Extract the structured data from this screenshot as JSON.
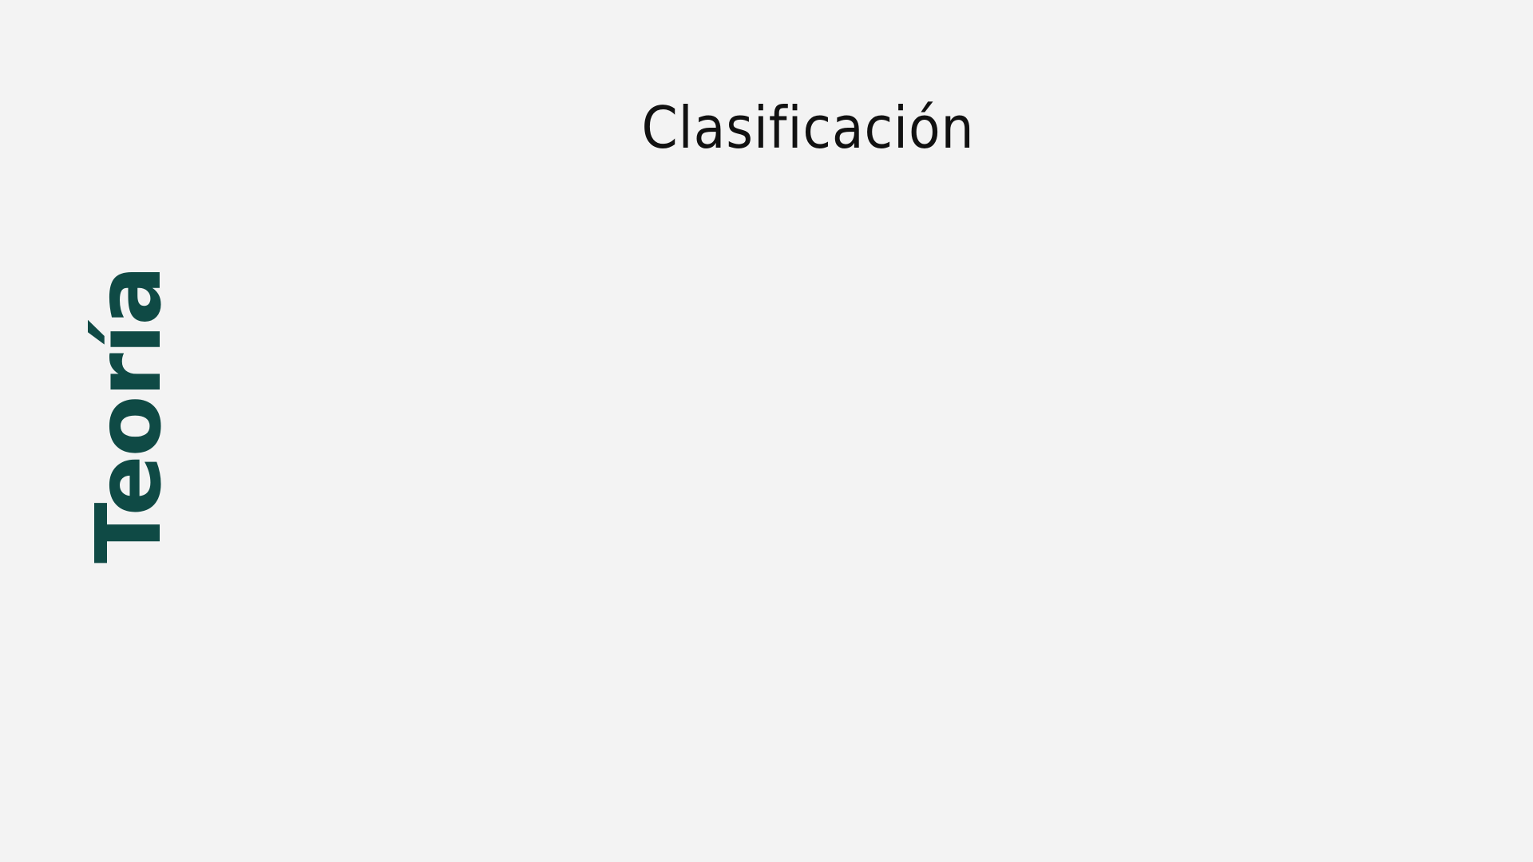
{
  "slide": {
    "title": "Clasificación",
    "section_label": "Teoría"
  },
  "colors": {
    "background": "#f3f3f3",
    "title": "#111111",
    "accent": "#0f4a45"
  }
}
